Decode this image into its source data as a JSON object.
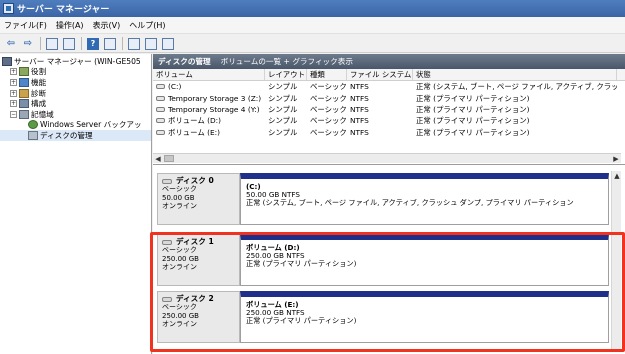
{
  "window": {
    "title": "サーバー マネージャー"
  },
  "menu": [
    "ファイル(F)",
    "操作(A)",
    "表示(V)",
    "ヘルプ(H)"
  ],
  "tree": {
    "root": "サーバー マネージャー (WIN-GE505",
    "items": [
      {
        "label": "役割",
        "icon": "role-icon"
      },
      {
        "label": "機能",
        "icon": "feature-icon"
      },
      {
        "label": "診断",
        "icon": "diagnostics-icon"
      },
      {
        "label": "構成",
        "icon": "configuration-icon"
      },
      {
        "label": "記憶域",
        "icon": "storage-icon"
      }
    ],
    "children": [
      {
        "label": "Windows Server バックアッ",
        "icon": "backup-icon"
      },
      {
        "label": "ディスクの管理",
        "icon": "disk-management-icon"
      }
    ]
  },
  "pane": {
    "title": "ディスクの管理",
    "subtitle": "ボリュームの一覧 + グラフィック表示"
  },
  "volume_table": {
    "headers": [
      "ボリューム",
      "レイアウト",
      "種類",
      "ファイル システム",
      "状態"
    ],
    "rows": [
      [
        "(C:)",
        "シンプル",
        "ベーシック",
        "NTFS",
        "正常 (システム, ブート, ページ ファイル, アクティブ, クラッシュ"
      ],
      [
        "Temporary Storage 3 (Z:)",
        "シンプル",
        "ベーシック",
        "NTFS",
        "正常 (プライマリ パーティション)"
      ],
      [
        "Temporary Storage 4 (Y:)",
        "シンプル",
        "ベーシック",
        "NTFS",
        "正常 (プライマリ パーティション)"
      ],
      [
        "ボリューム (D:)",
        "シンプル",
        "ベーシック",
        "NTFS",
        "正常 (プライマリ パーティション)"
      ],
      [
        "ボリューム (E:)",
        "シンプル",
        "ベーシック",
        "NTFS",
        "正常 (プライマリ パーティション)"
      ]
    ]
  },
  "disks": [
    {
      "name": "ディスク 0",
      "type": "ベーシック",
      "size": "50.00 GB",
      "status": "オンライン",
      "partition": {
        "name": "(C:)",
        "size_fs": "50.00 GB NTFS",
        "state": "正常 (システム, ブート, ページ ファイル, アクティブ, クラッシュ ダンプ, プライマリ パーティション"
      }
    },
    {
      "name": "ディスク 1",
      "type": "ベーシック",
      "size": "250.00 GB",
      "status": "オンライン",
      "partition": {
        "name": "ボリューム (D:)",
        "size_fs": "250.00 GB NTFS",
        "state": "正常 (プライマリ パーティション)"
      }
    },
    {
      "name": "ディスク 2",
      "type": "ベーシック",
      "size": "250.00 GB",
      "status": "オンライン",
      "partition": {
        "name": "ボリューム (E:)",
        "size_fs": "250.00 GB NTFS",
        "state": "正常 (プライマリ パーティション)"
      }
    }
  ],
  "colors": {
    "highlight": "#f0321e",
    "partition_bar": "#1f2f8a",
    "pane_header": "#4a576a"
  }
}
